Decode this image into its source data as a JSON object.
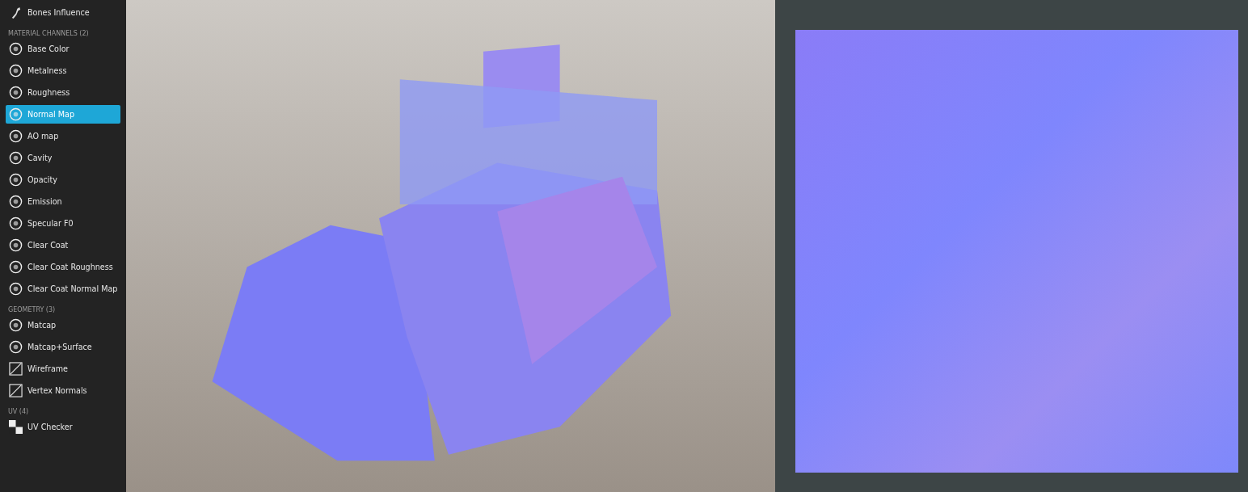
{
  "sidebar": {
    "top_item": {
      "label": "Bones Influence",
      "selected": false
    },
    "sections": [
      {
        "title": "MATERIAL CHANNELS (2)",
        "items": [
          {
            "label": "Base Color",
            "selected": false
          },
          {
            "label": "Metalness",
            "selected": false
          },
          {
            "label": "Roughness",
            "selected": false
          },
          {
            "label": "Normal Map",
            "selected": true
          },
          {
            "label": "AO map",
            "selected": false
          },
          {
            "label": "Cavity",
            "selected": false
          },
          {
            "label": "Opacity",
            "selected": false
          },
          {
            "label": "Emission",
            "selected": false
          },
          {
            "label": "Specular F0",
            "selected": false
          },
          {
            "label": "Clear Coat",
            "selected": false
          },
          {
            "label": "Clear Coat Roughness",
            "selected": false
          },
          {
            "label": "Clear Coat Normal Map",
            "selected": false
          }
        ]
      },
      {
        "title": "GEOMETRY (3)",
        "items": [
          {
            "label": "Matcap",
            "selected": false
          },
          {
            "label": "Matcap+Surface",
            "selected": false
          },
          {
            "label": "Wireframe",
            "selected": false
          },
          {
            "label": "Vertex Normals",
            "selected": false
          }
        ]
      },
      {
        "title": "UV (4)",
        "items": [
          {
            "label": "UV Checker",
            "selected": false
          }
        ]
      }
    ]
  }
}
